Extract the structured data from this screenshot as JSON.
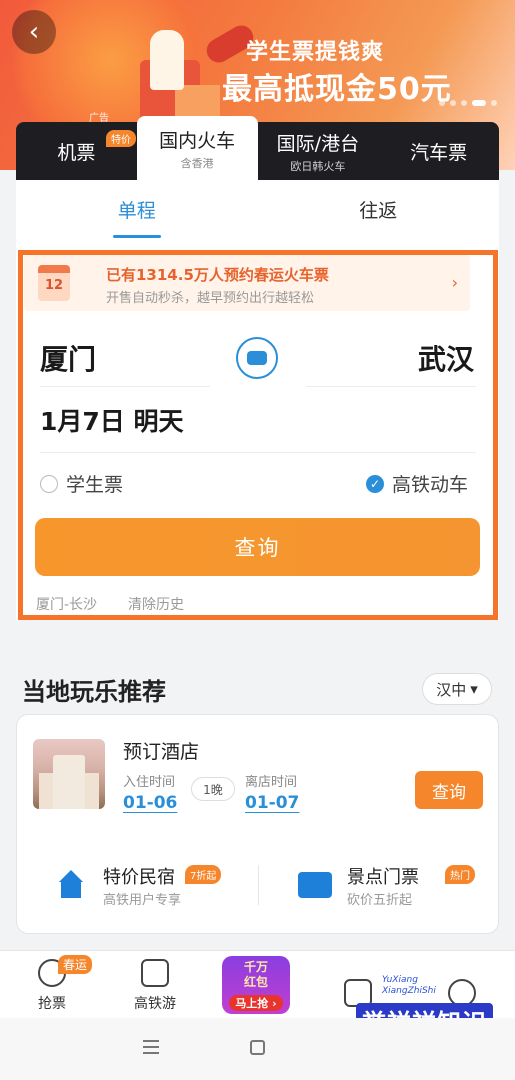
{
  "banner": {
    "promo_line1": "学生票提钱爽",
    "promo_line2": "最高抵现金50元",
    "ad_label": "广告",
    "back_icon": "chevron-left-icon"
  },
  "transport_tabs": [
    {
      "label": "机票",
      "sub": "",
      "badge": "特价"
    },
    {
      "label": "国内火车",
      "sub": "含香港",
      "badge": ""
    },
    {
      "label": "国际/港台",
      "sub": "欧日韩火车",
      "badge": ""
    },
    {
      "label": "汽车票",
      "sub": "",
      "badge": ""
    }
  ],
  "trip_tabs": [
    "单程",
    "往返"
  ],
  "notice": {
    "calendar_num": "12",
    "title": "已有1314.5万人预约春运火车票",
    "subtitle": "开售自动秒杀，越早预约出行越轻松"
  },
  "route": {
    "from": "厦门",
    "to": "武汉"
  },
  "date": "1月7日 明天",
  "options": {
    "student": "学生票",
    "hsr": "高铁动车",
    "hsr_check": "✓"
  },
  "search_label": "查询",
  "history": [
    "厦门-长沙",
    "清除历史"
  ],
  "local": {
    "title": "当地玩乐推荐",
    "city": "汉中",
    "city_arrow": "▾"
  },
  "hotel": {
    "title": "预订酒店",
    "checkin_label": "入住时间",
    "checkin": "01-06",
    "nights": "1晚",
    "checkout_label": "离店时间",
    "checkout": "01-07",
    "search": "查询"
  },
  "services": [
    {
      "title": "特价民宿",
      "sub": "高铁用户专享",
      "badge": "7折起"
    },
    {
      "title": "景点门票",
      "sub": "砍价五折起",
      "badge": "热门"
    }
  ],
  "nav": {
    "items": [
      {
        "label": "抢票",
        "badge": "春运"
      },
      {
        "label": "高铁游",
        "badge": ""
      }
    ],
    "promo_top": "千万\n红包",
    "promo_btn": "马上抢 ›"
  },
  "watermark": {
    "sub1": "YuXiang",
    "sub2": "XiangZhiShi",
    "main": "誉祥祥知识"
  },
  "colors": {
    "accent_blue": "#2a8fd8",
    "accent_orange": "#f6862c",
    "frame_orange": "#f5742a"
  }
}
